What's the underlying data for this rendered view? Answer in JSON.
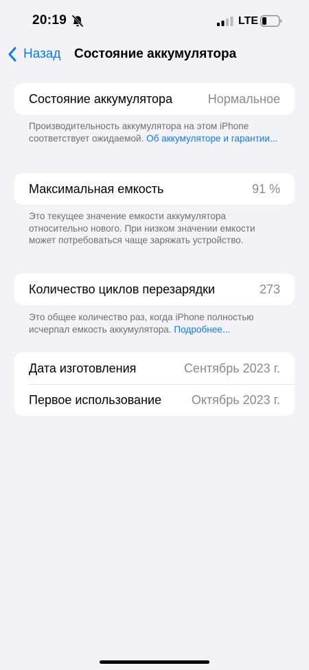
{
  "status_bar": {
    "time": "20:19",
    "network": "LTE",
    "icons": [
      "bell-slash-icon",
      "signal-icon",
      "battery-icon"
    ]
  },
  "nav": {
    "back_label": "Назад",
    "title": "Состояние аккумулятора",
    "accent_color": "#0a7aff"
  },
  "health": {
    "label": "Состояние аккумулятора",
    "value": "Нормальное",
    "footnote": "Производительность аккумулятора на этом iPhone соответствует ожидаемой.",
    "link": "Об аккумуляторе и гарантии..."
  },
  "capacity": {
    "label": "Максимальная емкость",
    "value": "91 %",
    "footnote": "Это текущее значение емкости аккумулятора относительно нового. При низком значении емкости может потребоваться чаще заряжать устройство."
  },
  "cycles": {
    "label": "Количество циклов перезарядки",
    "value": "273",
    "footnote": "Это общее количество раз, когда iPhone полностью исчерпал емкость аккумулятора.",
    "link": "Подробнее..."
  },
  "dates": {
    "manufacture_label": "Дата изготовления",
    "manufacture_value": "Сентябрь 2023 г.",
    "first_use_label": "Первое использование",
    "first_use_value": "Октябрь 2023 г."
  }
}
